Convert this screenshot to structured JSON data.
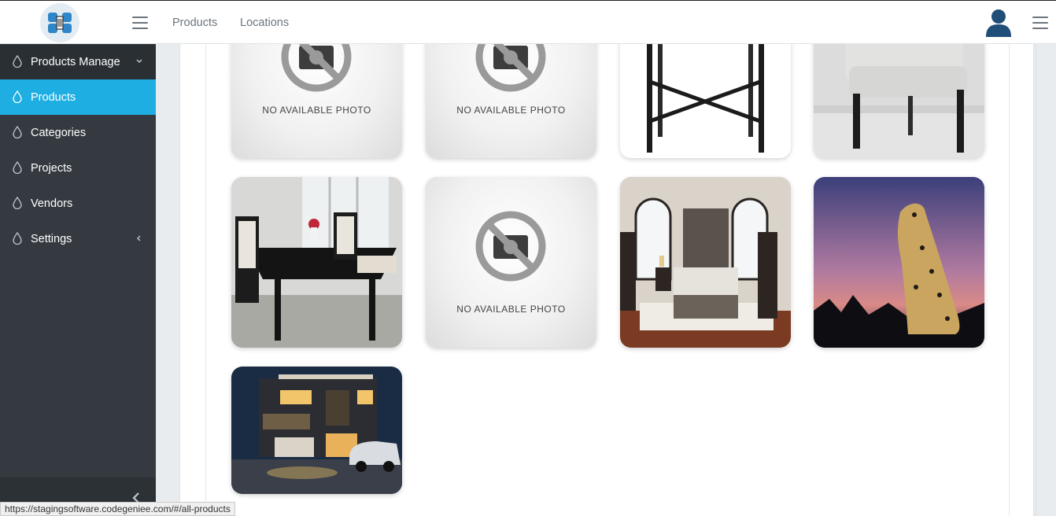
{
  "nav": {
    "links": [
      "Products",
      "Locations"
    ]
  },
  "sidebar": {
    "items": [
      {
        "label": "Products Manage",
        "icon": "drop-icon",
        "chevron": "chevron-down-icon"
      },
      {
        "label": "Products",
        "icon": "drop-icon",
        "active": true
      },
      {
        "label": "Categories",
        "icon": "drop-icon"
      },
      {
        "label": "Projects",
        "icon": "drop-icon"
      },
      {
        "label": "Vendors",
        "icon": "drop-icon"
      },
      {
        "label": "Settings",
        "icon": "drop-icon",
        "chevron": "chevron-left-icon"
      }
    ]
  },
  "gallery": {
    "no_photo_text": "NO AVAILABLE PHOTO",
    "tiles": [
      {
        "kind": "no-photo"
      },
      {
        "kind": "no-photo"
      },
      {
        "kind": "table-legs"
      },
      {
        "kind": "chair"
      },
      {
        "kind": "dining-set"
      },
      {
        "kind": "no-photo"
      },
      {
        "kind": "bedroom"
      },
      {
        "kind": "cheetah"
      },
      {
        "kind": "house"
      }
    ]
  },
  "statusbar": {
    "url": "https://stagingsoftware.codegeniee.com/#/all-products"
  },
  "colors": {
    "sidebar_bg": "#343a40",
    "active": "#1eaee2",
    "avatar": "#1f4e79"
  }
}
